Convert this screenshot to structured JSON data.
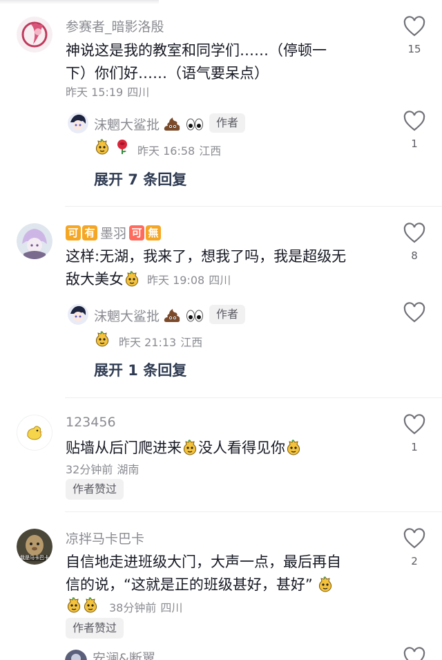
{
  "comments": [
    {
      "username": "参赛者_暗影洛殷",
      "text_line1": "神说这是我的教室和同学们……（停顿一",
      "text_line2": "下）你们好……（语气要呆点）",
      "time": "昨天 15:19",
      "location": "四川",
      "likes": "15",
      "reply": {
        "username": "沫魍大鲨批",
        "tag": "作者",
        "time": "昨天 16:58",
        "location": "江西",
        "likes": "1"
      },
      "expand_label": "展开 7 条回复"
    },
    {
      "username_badges": [
        "可",
        "有"
      ],
      "username": "墨羽",
      "username_badges_after": [
        "可",
        "無"
      ],
      "text_line1": "这样:无湖，我来了，想我了吗，我是超级无",
      "text_line2": "敌大美女",
      "time": "昨天 19:08",
      "location": "四川",
      "likes": "8",
      "reply": {
        "username": "沫魍大鲨批",
        "tag": "作者",
        "time": "昨天 21:13",
        "location": "江西",
        "likes": ""
      },
      "expand_label": "展开 1 条回复"
    },
    {
      "username": "123456",
      "text_line1a": "贴墙从后门爬进来",
      "text_line1b": "没人看得见你",
      "time": "32分钟前",
      "location": "湖南",
      "likes": "1",
      "author_liked": "作者赞过"
    },
    {
      "username": "凉拌马卡巴卡",
      "avatar_text": "我是马卡巴卡",
      "text_line1": "自信地走进班级大门，大声一点，最后再自",
      "text_line2": "信的说，“这就是正的班级甚好，甚好”",
      "time": "38分钟前",
      "location": "四川",
      "likes": "2",
      "author_liked": "作者赞过"
    },
    {
      "username": "安澜&断翼"
    }
  ],
  "colors": {
    "badge_orange": "#f5a623",
    "badge_red": "#ff6a5c",
    "text_primary": "#161823",
    "text_secondary": "#8a8b91",
    "expand_text": "#2f3b52"
  }
}
